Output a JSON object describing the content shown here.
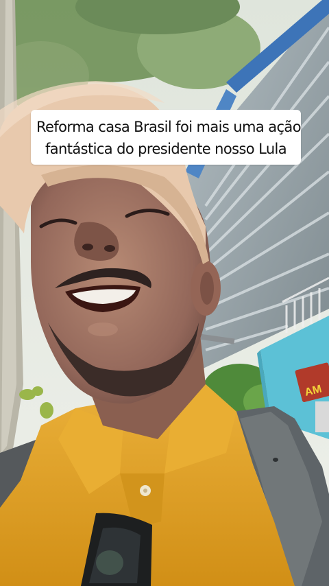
{
  "caption": {
    "line1": "Reforma casa Brasil foi mais uma ação",
    "line2": "fantástica do presidente nosso Lula"
  },
  "store_sign": {
    "text": "AM"
  },
  "colors": {
    "shirt": "#e3a21f",
    "cap": "#e8c9ad",
    "wall": "#5cc1d6",
    "roof": "#9aa7ad",
    "tree": "#6c8f55",
    "caption_bg": "#ffffff"
  }
}
